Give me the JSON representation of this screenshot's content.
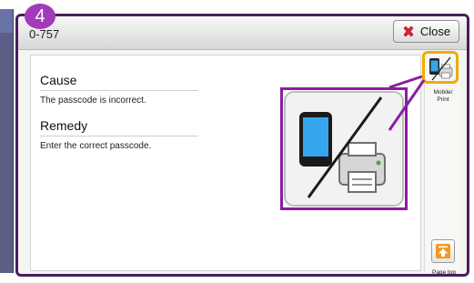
{
  "step": {
    "number": "4"
  },
  "dialog": {
    "error_code": "0-757",
    "close_label": "Close"
  },
  "cause": {
    "heading": "Cause",
    "text": "The passcode is incorrect."
  },
  "remedy": {
    "heading": "Remedy",
    "text": "Enter the correct passcode."
  },
  "sidebar": {
    "mobile_print": {
      "label_line1": "Mobile/",
      "label_line2": "Print",
      "icon": "mobile-print-icon"
    },
    "page_top": {
      "label": "Page top",
      "icon": "page-top-icon"
    }
  },
  "colors": {
    "highlight": "#f0ac00",
    "zoom_frame": "#8a1ea1",
    "badge": "#a23bb9",
    "frame_border": "#4b1d5a"
  }
}
